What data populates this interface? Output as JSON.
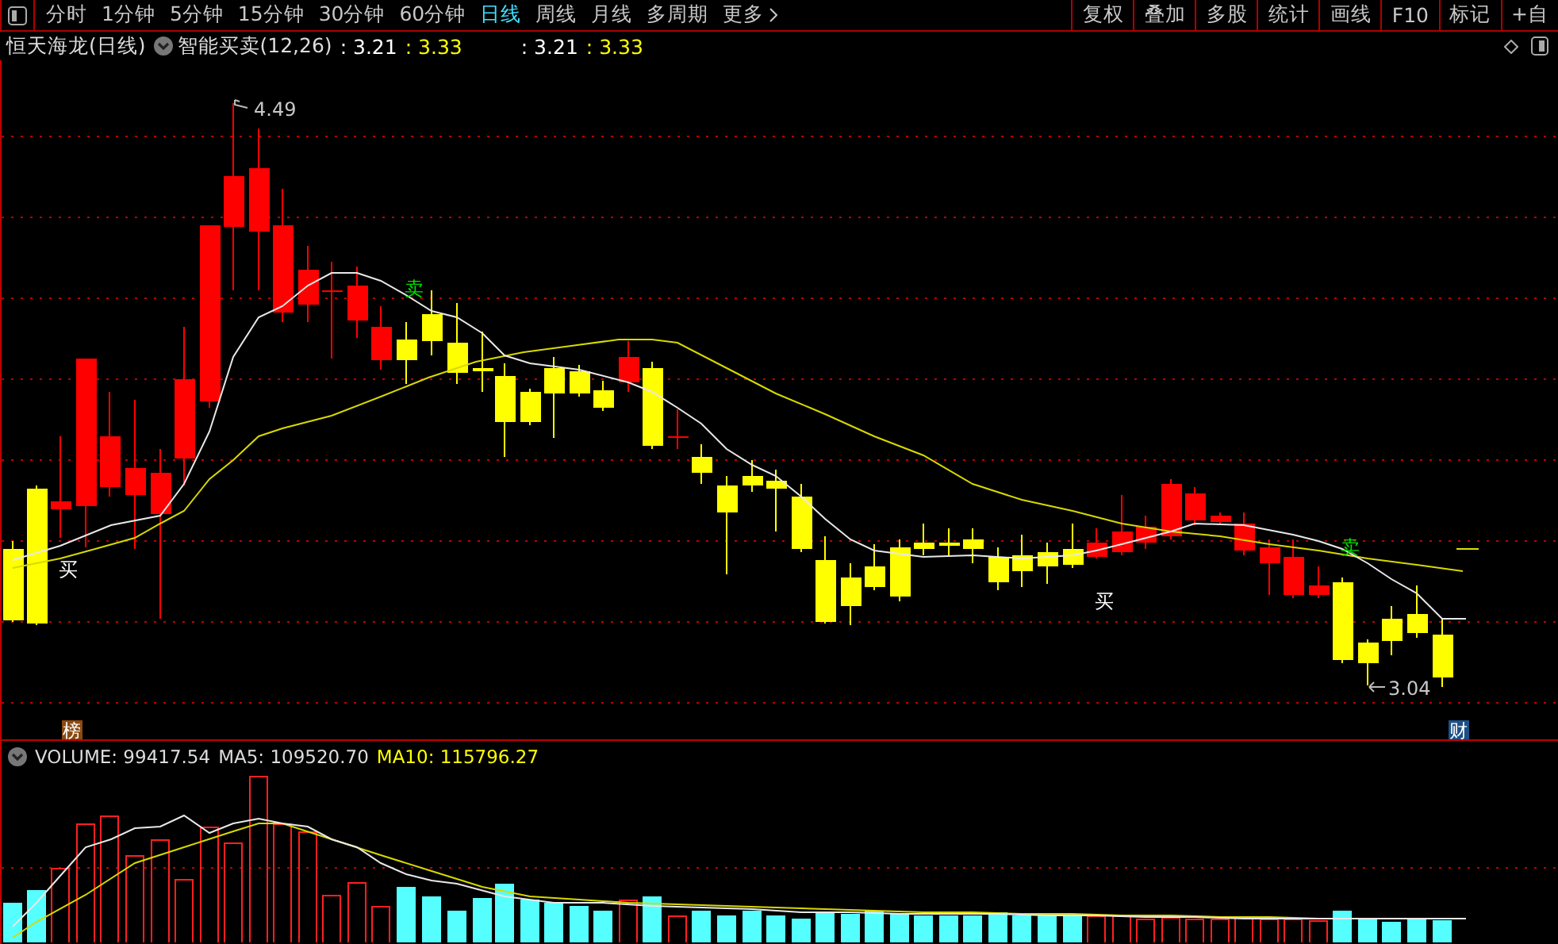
{
  "toolbar": {
    "tabs": [
      {
        "label": "分时",
        "selected": false
      },
      {
        "label": "1分钟",
        "selected": false
      },
      {
        "label": "5分钟",
        "selected": false
      },
      {
        "label": "15分钟",
        "selected": false
      },
      {
        "label": "30分钟",
        "selected": false
      },
      {
        "label": "60分钟",
        "selected": false
      },
      {
        "label": "日线",
        "selected": true
      },
      {
        "label": "周线",
        "selected": false
      },
      {
        "label": "月线",
        "selected": false
      },
      {
        "label": "多周期",
        "selected": false
      },
      {
        "label": "更多",
        "selected": false
      }
    ],
    "buttons": [
      "复权",
      "叠加",
      "多股",
      "统计",
      "画线",
      "F10",
      "标记",
      "+自"
    ]
  },
  "legend": {
    "stock": "恒天海龙(日线)",
    "indicator": "智能买卖(12,26)",
    "values": [
      {
        "text": ": 3.21",
        "color": "#ffffff"
      },
      {
        "text": ": 3.33",
        "color": "#ffff00"
      },
      {
        "text": ": 3.21",
        "color": "#ffffff"
      },
      {
        "text": ": 3.33",
        "color": "#ffff00"
      }
    ]
  },
  "price_chart": {
    "high_label": "4.49",
    "low_label": "3.04",
    "signals": [
      {
        "kind": "buy",
        "text": "买"
      },
      {
        "kind": "sell",
        "text": "卖"
      },
      {
        "kind": "buy",
        "text": "买"
      },
      {
        "kind": "sell",
        "text": "卖"
      }
    ],
    "badges": [
      {
        "text": "榜",
        "color": "#8b4a10"
      },
      {
        "text": "财",
        "color": "#1d4f86"
      }
    ]
  },
  "volume_legend": {
    "volume": "VOLUME: 99417.54",
    "ma5": "MA5: 109520.70",
    "ma10": "MA10: 115796.27"
  }
}
